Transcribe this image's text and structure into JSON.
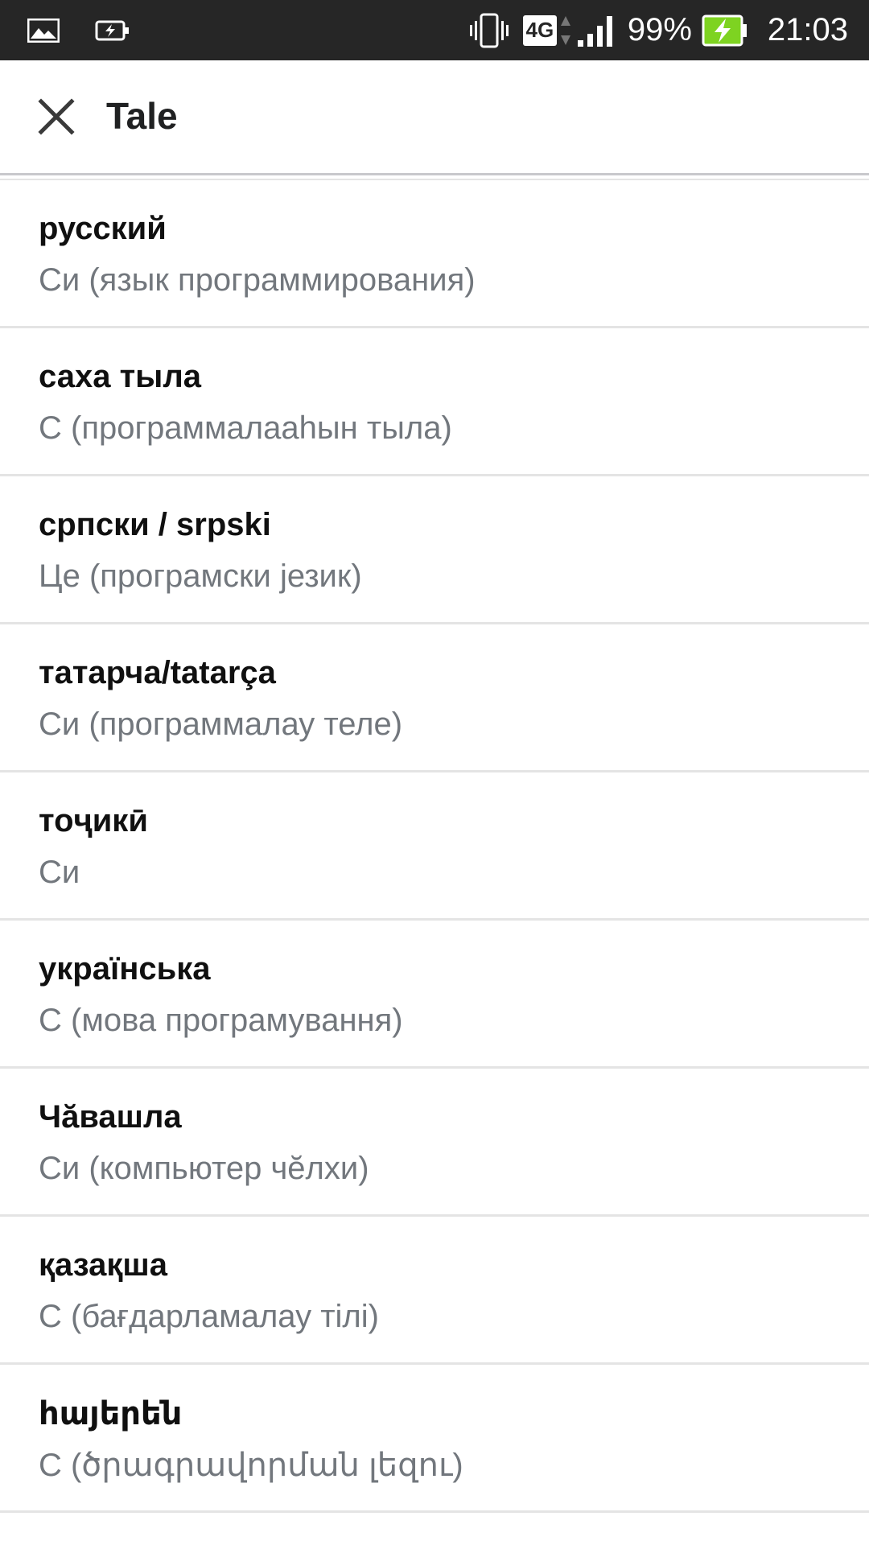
{
  "status_bar": {
    "network": "4G",
    "battery": "99%",
    "time": "21:03",
    "icons": [
      "image-icon",
      "battery-saver-icon",
      "vibrate-icon",
      "signal-icon",
      "battery-charging-icon"
    ],
    "battery_color": "#7ed321"
  },
  "app_bar": {
    "title": "Tale",
    "close_icon": "close-icon"
  },
  "languages": [
    {
      "lang": "русский",
      "title": "Си (язык программирования)"
    },
    {
      "lang": "саха тыла",
      "title": "C (программалааһын тыла)"
    },
    {
      "lang": "српски / srpski",
      "title": "Це (програмски језик)"
    },
    {
      "lang": "татарча/tatarça",
      "title": "Си (программалау теле)"
    },
    {
      "lang": "тоҷикӣ",
      "title": "Си"
    },
    {
      "lang": "українська",
      "title": "C (мова програмування)"
    },
    {
      "lang": "Чӑвашла",
      "title": "Си (компьютер чӗлхи)"
    },
    {
      "lang": "қазақша",
      "title": "C (бағдарламалау тілі)"
    },
    {
      "lang": "հայերեն",
      "title": "C (ծրագրավորման լեզու)"
    }
  ]
}
